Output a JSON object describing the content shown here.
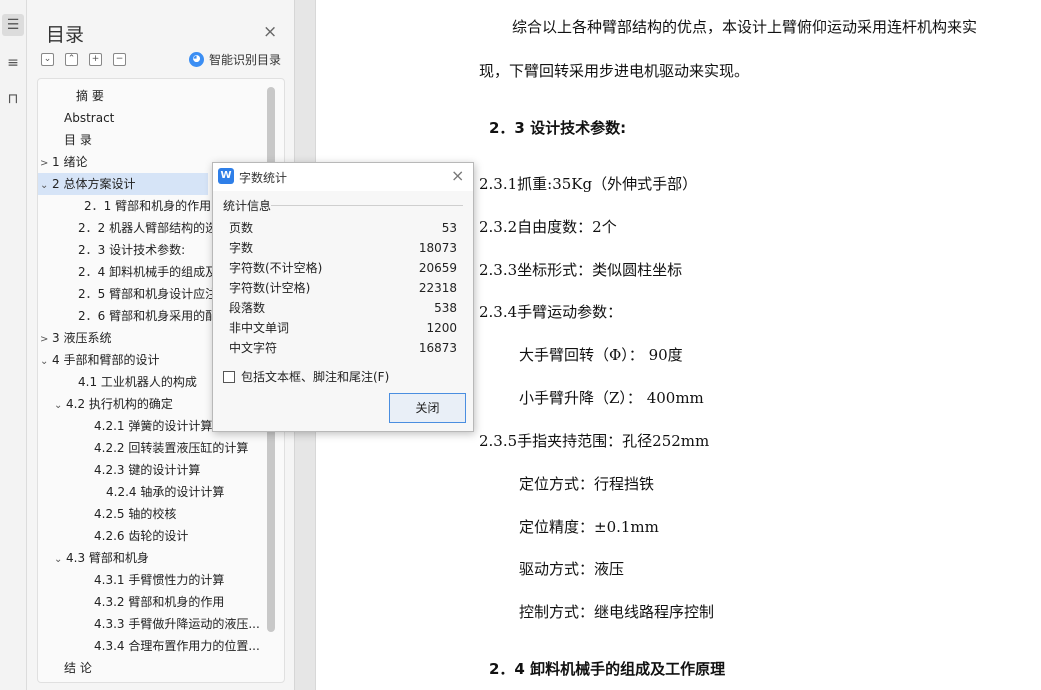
{
  "rail": {
    "icons": [
      "toc-icon",
      "list-icon",
      "bookmark-icon"
    ]
  },
  "toc": {
    "title": "目录",
    "close": "×",
    "tools": [
      "⌄",
      "⌃",
      "+",
      "−"
    ],
    "smart_label": "智能识别目录",
    "items": [
      {
        "label": "摘  要",
        "arrow": ""
      },
      {
        "label": "Abstract",
        "arrow": ""
      },
      {
        "label": "目    录",
        "arrow": ""
      },
      {
        "label": "1   绪论",
        "arrow": ">"
      },
      {
        "label": "2   总体方案设计",
        "arrow": "⌄"
      },
      {
        "label": "2．1 臂部和机身的作用",
        "arrow": ""
      },
      {
        "label": "2．2 机器人臂部结构的选",
        "arrow": ""
      },
      {
        "label": "2．3 设计技术参数:",
        "arrow": ""
      },
      {
        "label": "2．4 卸料机械手的组成及",
        "arrow": ""
      },
      {
        "label": "2．5 臂部和机身设计应注",
        "arrow": ""
      },
      {
        "label": "2．6 臂部和机身采用的配",
        "arrow": ""
      },
      {
        "label": "3   液压系统",
        "arrow": ">"
      },
      {
        "label": "4   手部和臂部的设计",
        "arrow": "⌄"
      },
      {
        "label": "4.1 工业机器人的构成",
        "arrow": ""
      },
      {
        "label": "4.2 执行机构的确定",
        "arrow": "⌄"
      },
      {
        "label": "4.2.1 弹簧的设计计算",
        "arrow": ""
      },
      {
        "label": "4.2.2 回转装置液压缸的计算",
        "arrow": ""
      },
      {
        "label": "4.2.3  键的设计计算",
        "arrow": ""
      },
      {
        "label": "4.2.4  轴承的设计计算",
        "arrow": ""
      },
      {
        "label": "4.2.5 轴的校核",
        "arrow": ""
      },
      {
        "label": "4.2.6 齿轮的设计",
        "arrow": ""
      },
      {
        "label": "4.3 臂部和机身",
        "arrow": "⌄"
      },
      {
        "label": "4.3.1 手臂惯性力的计算",
        "arrow": ""
      },
      {
        "label": "4.3.2 臂部和机身的作用",
        "arrow": ""
      },
      {
        "label": "4.3.3 手臂做升降运动的液压...",
        "arrow": ""
      },
      {
        "label": "4.3.4 合理布置作用力的位置...",
        "arrow": ""
      },
      {
        "label": "结   论",
        "arrow": ""
      }
    ]
  },
  "document": {
    "lines": [
      "综合以上各种臂部结构的优点，本设计上臂俯仰运动采用连杆机构来实",
      "现，下臂回转采用步进电机驱动来实现。",
      "2．3 设计技术参数:",
      "2.3.1抓重:35Kg（外伸式手部）",
      "2.3.2自由度数：2个",
      "2.3.3坐标形式：类似圆柱坐标",
      "2.3.4手臂运动参数：",
      "大手臂回转（Φ）：   90度",
      "小手臂升降（Z）：   400mm",
      "2.3.5手指夹持范围：孔径252mm",
      "定位方式：行程挡铁",
      "定位精度：±0.1mm",
      "驱动方式：液压",
      "控制方式：继电线路程序控制",
      "2．4 卸料机械手的组成及工作原理"
    ]
  },
  "dialog": {
    "logo": "W",
    "title": "字数统计",
    "close": "×",
    "section": "统计信息",
    "stats": [
      {
        "label": "页数",
        "value": "53"
      },
      {
        "label": "字数",
        "value": "18073"
      },
      {
        "label": "字符数(不计空格)",
        "value": "20659"
      },
      {
        "label": "字符数(计空格)",
        "value": "22318"
      },
      {
        "label": "段落数",
        "value": "538"
      },
      {
        "label": "非中文单词",
        "value": "1200"
      },
      {
        "label": "中文字符",
        "value": "16873"
      }
    ],
    "checkbox_label": "包括文本框、脚注和尾注(F)",
    "close_button": "关闭"
  }
}
